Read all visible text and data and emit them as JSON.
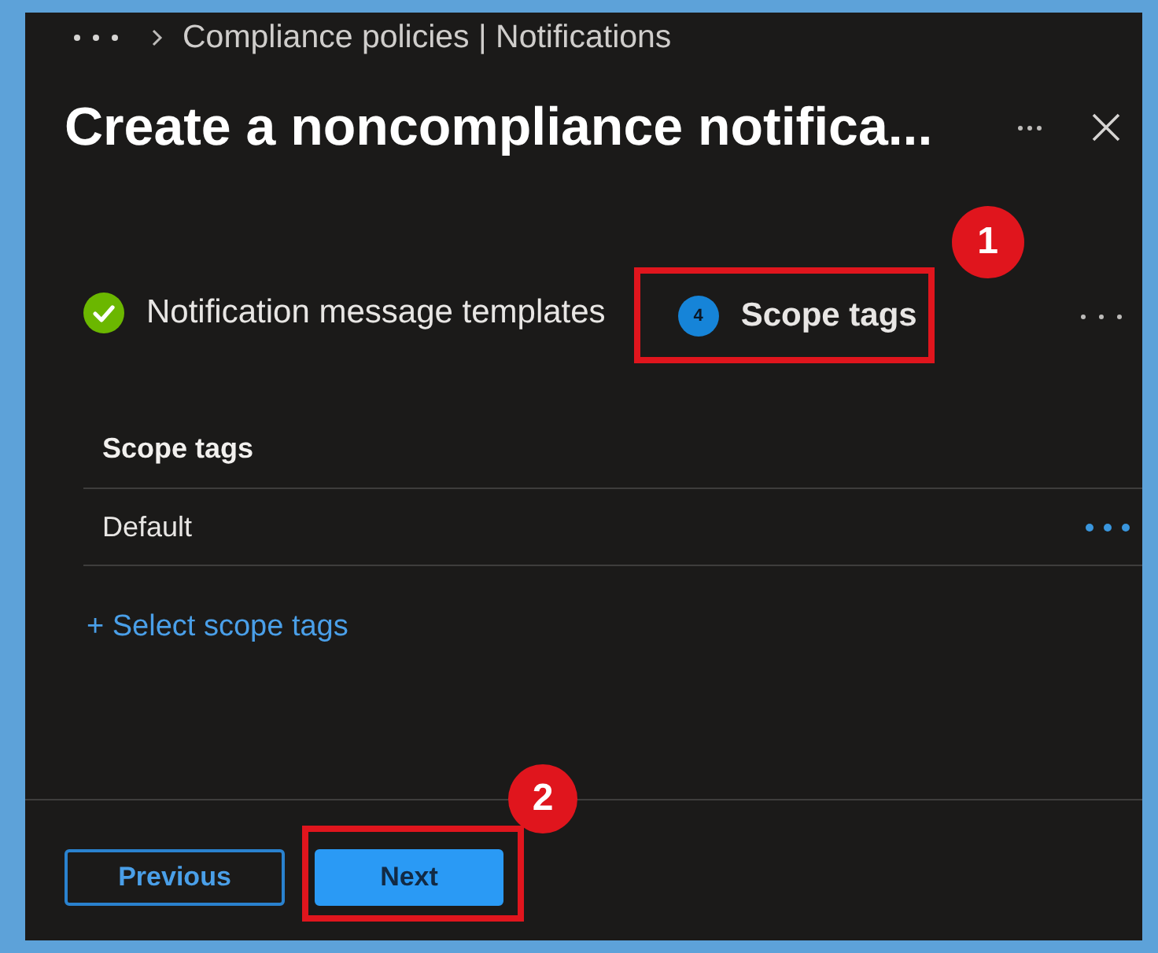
{
  "breadcrumb": {
    "path": "Compliance policies | Notifications"
  },
  "header": {
    "title": "Create a noncompliance notifica..."
  },
  "steps": [
    {
      "kind": "completed",
      "label": "Notification message templates",
      "selected": false
    },
    {
      "kind": "current",
      "number": "4",
      "label": "Scope tags",
      "selected": true,
      "callout": "1"
    }
  ],
  "scope_tags": {
    "heading": "Scope tags",
    "rows": [
      {
        "name": "Default"
      }
    ],
    "add_link": "+ Select scope tags"
  },
  "footer": {
    "buttons": [
      {
        "kind": "secondary",
        "label": "Previous"
      },
      {
        "kind": "primary",
        "label": "Next",
        "callout": "2"
      }
    ]
  }
}
